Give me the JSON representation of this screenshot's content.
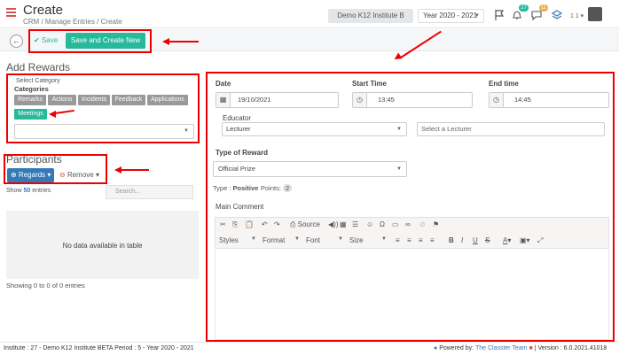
{
  "header": {
    "title": "Create",
    "breadcrumb": [
      "CRM",
      "Manage Entries",
      "Create"
    ],
    "institute": "Demo K12 Institute B",
    "year": "Year 2020 - 2021",
    "notif_count_1": "27",
    "notif_count_2": "11",
    "user_label": "1 1"
  },
  "toolbar": {
    "save_label": "Save",
    "save_create_label": "Save and Create New"
  },
  "left": {
    "section_title": "Add Rewards",
    "select_category_label": "Select Category",
    "categories_label": "Categories",
    "categories": [
      "Remarks",
      "Actions",
      "Incidents",
      "Feedback",
      "Applications"
    ],
    "selected_category": "Meetings",
    "participants_title": "Participants",
    "regards_label": "Regards",
    "remove_label": "Remove",
    "show_prefix": "Show",
    "show_count": "50",
    "show_suffix": "entries",
    "search_placeholder": "Search...",
    "empty_table": "No data available in table",
    "table_info": "Showing 0 to 0 of 0 entries"
  },
  "form": {
    "date_label": "Date",
    "date_value": "19/10/2021",
    "start_label": "Start Time",
    "start_value": "13:45",
    "end_label": "End time",
    "end_value": "14:45",
    "educator_label": "Educator",
    "educator_value": "Lecturer",
    "lecturer_placeholder": "Select a Lecturer",
    "reward_label": "Type of Reward",
    "reward_value": "Official Prize",
    "type_label": "Type :",
    "type_value": "Positive",
    "points_label": "Points:",
    "points_value": "2",
    "comment_label": "Main Comment",
    "source_label": "Source",
    "styles_label": "Styles",
    "format_label": "Format",
    "font_label": "Font",
    "size_label": "Size"
  },
  "footer": {
    "left_text": "Institute : 27 - Demo K12 Institute BETA Period : 5 - Year 2020 - 2021",
    "powered_label": "Powered by:",
    "team_label": "The Classter Team",
    "version_text": "| Version : 6.0.2021.41018"
  },
  "colors": {
    "accent": "#26b99a",
    "primary": "#337ab7",
    "annotation": "#e00000"
  }
}
